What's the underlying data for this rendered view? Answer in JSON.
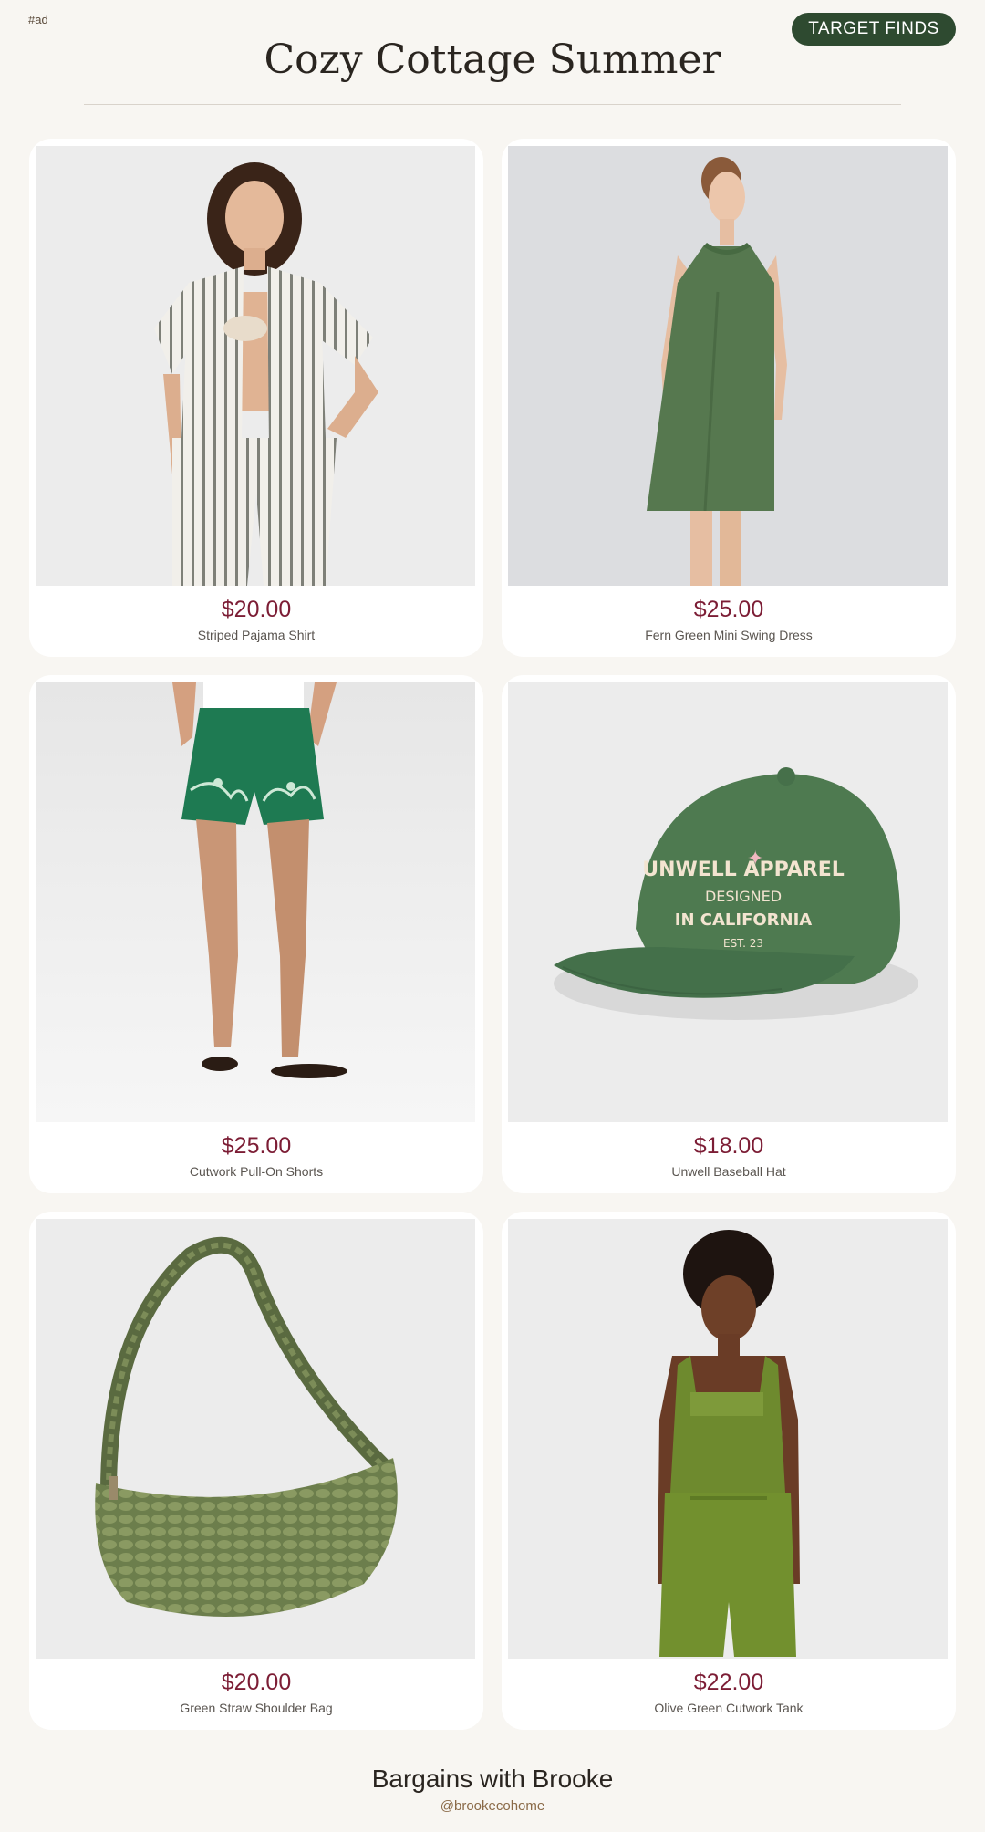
{
  "header": {
    "ad_tag": "#ad",
    "brand_button": "TARGET FINDS",
    "title": "Cozy Cottage Summer"
  },
  "products": [
    {
      "price": "$20.00",
      "name": "Striped Pajama Shirt",
      "image": "striped-pajama-shirt-photo"
    },
    {
      "price": "$25.00",
      "name": "Fern Green Mini Swing Dress",
      "image": "green-mini-dress-photo"
    },
    {
      "price": "$25.00",
      "name": "Cutwork Pull-On Shorts",
      "image": "green-cutwork-shorts-photo"
    },
    {
      "price": "$18.00",
      "name": "Unwell Baseball Hat",
      "image": "green-baseball-hat-photo"
    },
    {
      "price": "$20.00",
      "name": "Green Straw Shoulder Bag",
      "image": "green-straw-bag-photo"
    },
    {
      "price": "$22.00",
      "name": "Olive Green Cutwork Tank",
      "image": "olive-cutwork-tank-photo"
    }
  ],
  "hat_embroidery": {
    "line1": "UNWELL APPAREL",
    "line2": "DESIGNED",
    "line3": "IN CALIFORNIA",
    "line4": "EST. 23"
  },
  "footer": {
    "title": "Bargains with Brooke",
    "handle": "@brookecohome"
  },
  "colors": {
    "background": "#f8f6f2",
    "price": "#7c1d35",
    "brand_pill": "#2e4a30"
  }
}
